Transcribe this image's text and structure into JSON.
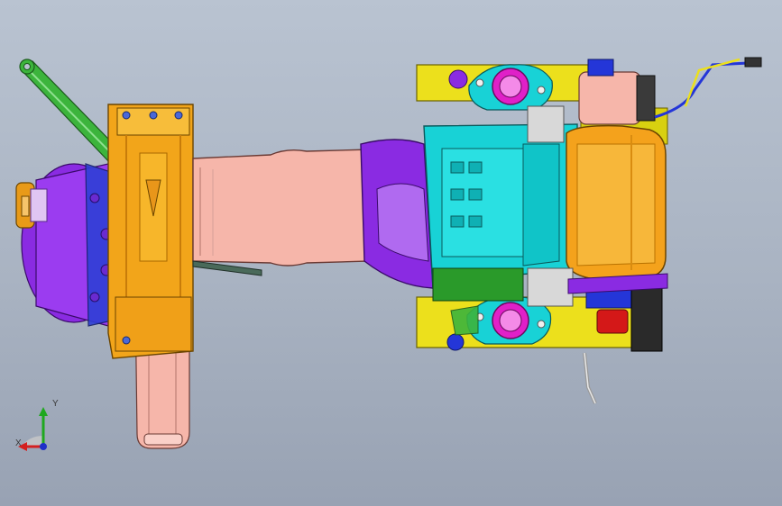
{
  "viewport": {
    "background_top": "#b9c3d1",
    "background_bottom": "#98a2b3"
  },
  "triad": {
    "x_label": "X",
    "y_label": "Y",
    "x_color": "#d42020",
    "y_color": "#1fa81f",
    "z_color": "#2030c8"
  },
  "part_colors": {
    "housing_orange": "#f2a51a",
    "tube_pink": "#f6b6aa",
    "gearbox_purple": "#8a2be2",
    "tank_orange": "#f4a21c",
    "cover_cyan": "#18d2d6",
    "frame_yellow": "#ece01c",
    "motor_blue": "#2436d8",
    "arm_green": "#3cb43c",
    "flange_magenta": "#e020c8"
  }
}
